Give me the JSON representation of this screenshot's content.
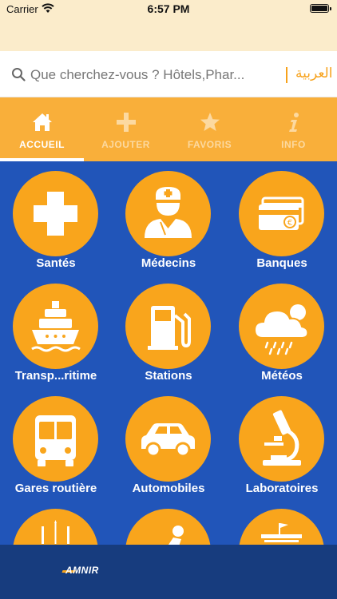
{
  "status_bar": {
    "carrier": "Carrier",
    "time": "6:57 PM",
    "battery_level": 1.0
  },
  "search": {
    "placeholder": "Que cherchez-vous ? Hôtels,Phar...",
    "language_toggle": "العربية"
  },
  "tabs": [
    {
      "label": "ACCUEIL",
      "icon": "home-icon",
      "active": true
    },
    {
      "label": "AJOUTER",
      "icon": "plus-icon",
      "active": false
    },
    {
      "label": "FAVORIS",
      "icon": "star-icon",
      "active": false
    },
    {
      "label": "INFO",
      "icon": "info-icon",
      "active": false
    }
  ],
  "categories": [
    {
      "label": "Santés",
      "icon": "medical-cross-icon"
    },
    {
      "label": "Médecins",
      "icon": "doctor-icon"
    },
    {
      "label": "Banques",
      "icon": "credit-card-icon"
    },
    {
      "label": "Transp...ritime",
      "icon": "ship-icon"
    },
    {
      "label": "Stations",
      "icon": "fuel-pump-icon"
    },
    {
      "label": "Météos",
      "icon": "weather-cloud-icon"
    },
    {
      "label": "Gares routière",
      "icon": "bus-icon"
    },
    {
      "label": "Automobiles",
      "icon": "car-icon"
    },
    {
      "label": "Laboratoires",
      "icon": "microscope-icon"
    },
    {
      "label": "",
      "icon": "bridge-icon"
    },
    {
      "label": "",
      "icon": "person-icon"
    },
    {
      "label": "",
      "icon": "building-icon"
    }
  ],
  "footer": {
    "brand": "AMNIR"
  },
  "colors": {
    "accent": "#f9a51c",
    "tab_bar": "#f9af3a",
    "grid_background": "#2155b9",
    "footer": "#173c7e"
  }
}
